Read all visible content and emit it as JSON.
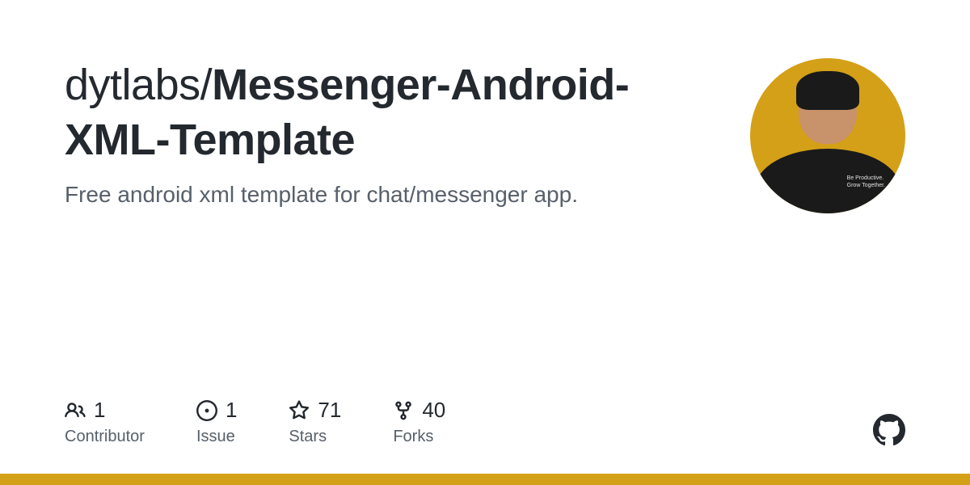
{
  "repo": {
    "owner": "dytlabs",
    "separator": "/",
    "name": "Messenger-Android-XML-Template",
    "description": "Free android xml template for chat/messenger app."
  },
  "avatar": {
    "shirt_text_line1": "Be Productive.",
    "shirt_text_line2": "Grow Together."
  },
  "stats": {
    "contributors": {
      "count": "1",
      "label": "Contributor"
    },
    "issues": {
      "count": "1",
      "label": "Issue"
    },
    "stars": {
      "count": "71",
      "label": "Stars"
    },
    "forks": {
      "count": "40",
      "label": "Forks"
    }
  },
  "colors": {
    "accent": "#d4a017"
  }
}
